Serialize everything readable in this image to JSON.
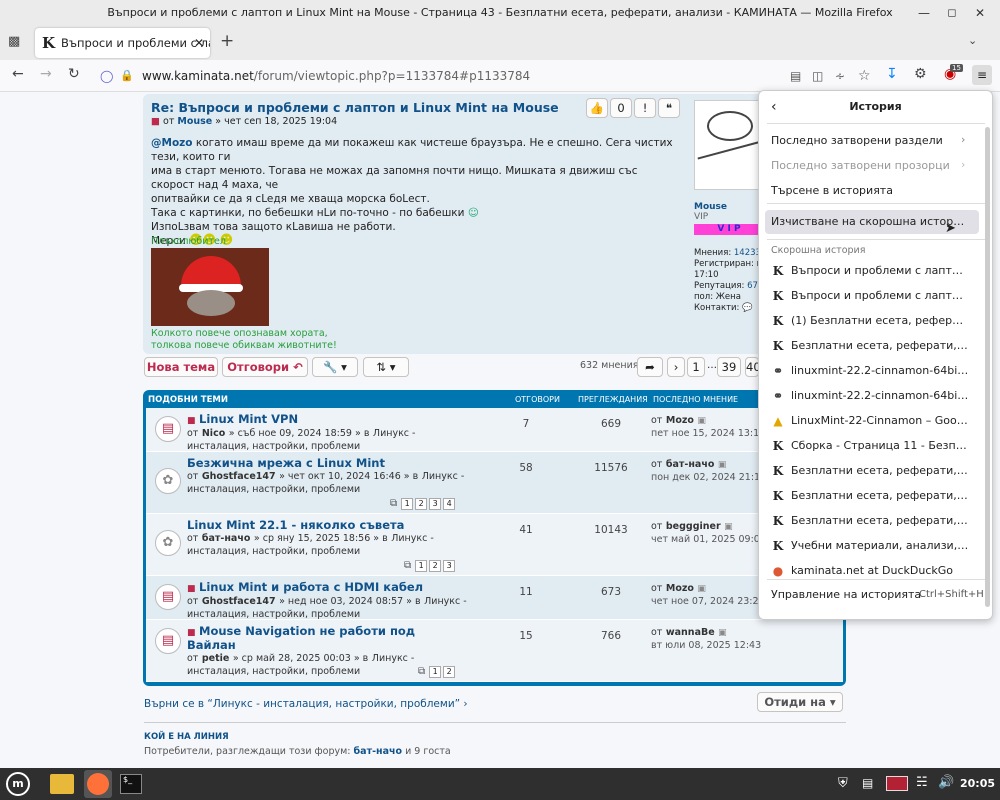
{
  "window_title": "Въпроси и проблеми с лаптоп и Linux Mint на Mouse - Страница 43 - Безплатни есета, реферати, анализи - КАМИНАТА — Mozilla Firefox",
  "tab": {
    "label": "Въпроси и проблеми с лап"
  },
  "url": {
    "domain": "www.kaminata.net",
    "path": "/forum/viewtopic.php?p=1133784#p1133784"
  },
  "ext_badge": "15",
  "post": {
    "title": "Re: Въпроси и проблеми с лаптоп и Linux Mint на Mouse",
    "by": "от",
    "author": "Mouse",
    "date": "» чет сеп 18, 2025 19:04",
    "quote_count": "0",
    "body_l1_a": "@Mozo",
    "body_l1_b": " когато имаш време да ми покажеш как чистеше браузъра. Не е спешно. Сега чистих тези, които ги",
    "body_l2": "има в старт менюто. Тогава не можах да запомня почти нищо. Мишката я движиш със скорост над 4 маха, че",
    "body_l3": "опитвайки се да я cLeдя ме хваща морска боLест.",
    "body_l4": "Така с картинки, по бебешки нLи по-точно - по бабешки",
    "body_l5": "ИзпоLзвам това защото кLавиша не работи.",
    "body_l6": "Мерси",
    "sig_top": "Плъхолюбител",
    "sig_l1": "Колкото повече опознавам хората,",
    "sig_l2": "толкова повече обиквам животните!",
    "profile": {
      "name": "Mouse",
      "rank": "VIP",
      "badge": "V I P",
      "posts_label": "Мнения:",
      "posts": "14233",
      "reg_label": "Регистриран:",
      "reg_value": "вт",
      "reg_time": "17:10",
      "rep_label": "Репутация:",
      "rep_value": "679",
      "sex_label": "пол:",
      "sex_value": "Жена",
      "contacts_label": "Контакти:"
    }
  },
  "actions": {
    "new_topic": "Нова тема",
    "reply": "Отговори",
    "posts_count": "632 мнения",
    "pages": [
      "1",
      "39",
      "40"
    ],
    "ellipsis": "…"
  },
  "similar": {
    "header": "ПОДОБНИ ТЕМИ",
    "col_replies": "ОТГОВОРИ",
    "col_views": "ПРЕГЛЕЖДАНИЯ",
    "col_last": "ПОСЛЕДНО МНЕНИЕ",
    "rows": [
      {
        "title": "Linux Mint VPN",
        "by": "от",
        "author": "Nico",
        "date": "» съб ное 09, 2024 18:59 » в",
        "forum": "Линукс - инсталация, настройки, проблеми",
        "replies": "7",
        "views": "669",
        "last_by": "от",
        "last_author": "Mozo",
        "last_date": "пет ное 15, 2024 13:19",
        "pages": []
      },
      {
        "title": "Безжична мрежа с Linux Mint",
        "by": "от",
        "author": "Ghostface147",
        "date": "» чет окт 10, 2024 16:46 » в",
        "forum": "Линукс - инсталация, настройки, проблеми",
        "replies": "58",
        "views": "11576",
        "last_by": "от",
        "last_author": "бат-начо",
        "last_date": "пон дек 02, 2024 21:19",
        "pages": [
          "1",
          "2",
          "3",
          "4"
        ]
      },
      {
        "title": "Linux Mint 22.1 - няколко съвета",
        "by": "от",
        "author": "бат-начо",
        "date": "» ср яну 15, 2025 18:56 » в",
        "forum": "Линукс - инсталация, настройки, проблеми",
        "replies": "41",
        "views": "10143",
        "last_by": "от",
        "last_author": "beggginer",
        "last_date": "чет май 01, 2025 09:05",
        "pages": [
          "1",
          "2",
          "3"
        ]
      },
      {
        "title": "Linux Mint и работа с HDMI кабел",
        "by": "от",
        "author": "Ghostface147",
        "date": "» нед ное 03, 2024 08:57 » в",
        "forum": "Линукс - инсталация, настройки, проблеми",
        "replies": "11",
        "views": "673",
        "last_by": "от",
        "last_author": "Mozo",
        "last_date": "чет ное 07, 2024 23:22",
        "pages": []
      },
      {
        "title": "Mouse Navigation не работи под Вайлан",
        "by": "от",
        "author": "petie",
        "date": "» ср май 28, 2025 00:03 » в",
        "forum": "Линукс - инсталация, настройки, проблеми",
        "replies": "15",
        "views": "766",
        "last_by": "от",
        "last_author": "wannaBe",
        "last_date": "вт юли 08, 2025 12:43",
        "pages": [
          "1",
          "2"
        ]
      }
    ]
  },
  "footer": {
    "back_link": "Върни се в “Линукс - инсталация, настройки, проблеми”",
    "goto": "Отиди на",
    "online_header": "КОЙ Е НА ЛИНИЯ",
    "online_text": "Потребители, разглеждащи този форум:",
    "online_user": "бат-начо",
    "online_rest": "и 9 госта"
  },
  "history": {
    "title": "История",
    "recent_closed_tabs": "Последно затворени раздели",
    "recent_closed_windows": "Последно затворени прозорци",
    "search": "Търсене в историята",
    "clear": "Изчистване на скорошна история…",
    "recent_header": "Скорошна история",
    "items": [
      {
        "icon": "K",
        "label": "Въпроси и проблеми с лаптоп и Li..."
      },
      {
        "icon": "K",
        "label": "Въпроси и проблеми с лаптоп и Li..."
      },
      {
        "icon": "K",
        "label": "(1) Безплатни есета, реферати, ана..."
      },
      {
        "icon": "K",
        "label": "Безплатни есета, реферати, анали..."
      },
      {
        "icon": "globe",
        "label": "linuxmint-22.2-cinnamon-64bit-respi..."
      },
      {
        "icon": "globe",
        "label": "linuxmint-22.2-cinnamon-64bit-respi..."
      },
      {
        "icon": "drive",
        "label": "LinuxMint-22-Cinnamon – Google Д..."
      },
      {
        "icon": "K",
        "label": "Сборка - Страница 11 - Безплатни ..."
      },
      {
        "icon": "K",
        "label": "Безплатни есета, реферати, анали..."
      },
      {
        "icon": "K",
        "label": "Безплатни есета, реферати, анали..."
      },
      {
        "icon": "K",
        "label": "Безплатни есета, реферати, анали..."
      },
      {
        "icon": "K",
        "label": "Учебни материали, анализи, рефе..."
      },
      {
        "icon": "ddg",
        "label": "kaminata.net at DuckDuckGo"
      }
    ],
    "manage": "Управление на историята",
    "manage_shortcut": "Ctrl+Shift+H"
  },
  "taskbar": {
    "clock": "20:05"
  },
  "colors": {
    "accent": "#0076b1",
    "link": "#105289",
    "red": "#bc2a4d",
    "green": "#28a03c"
  }
}
